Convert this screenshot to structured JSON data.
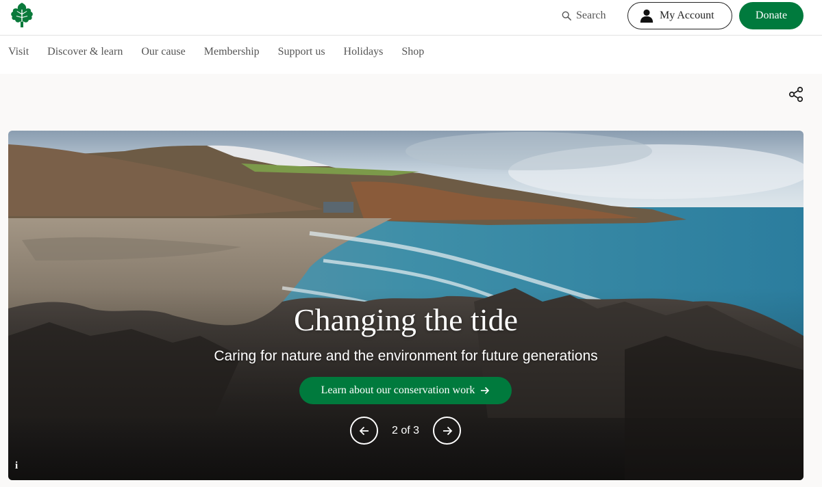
{
  "header": {
    "search_label": "Search",
    "account_label": "My Account",
    "donate_label": "Donate"
  },
  "nav": {
    "items": [
      "Visit",
      "Discover & learn",
      "Our cause",
      "Membership",
      "Support us",
      "Holidays",
      "Shop"
    ]
  },
  "hero": {
    "title": "Changing the tide",
    "subtitle": "Caring for nature and the environment for future generations",
    "cta_label": "Learn about our conservation work",
    "pager_label": "2 of 3",
    "info_label": "i"
  },
  "colors": {
    "brand_green": "#007a3d",
    "text_dark": "#2b2b2b",
    "nav_text": "#555555"
  },
  "icons": [
    "oak-leaf-logo-icon",
    "search-icon",
    "account-icon",
    "share-icon",
    "arrow-right-icon",
    "arrow-left-icon",
    "info-icon"
  ]
}
